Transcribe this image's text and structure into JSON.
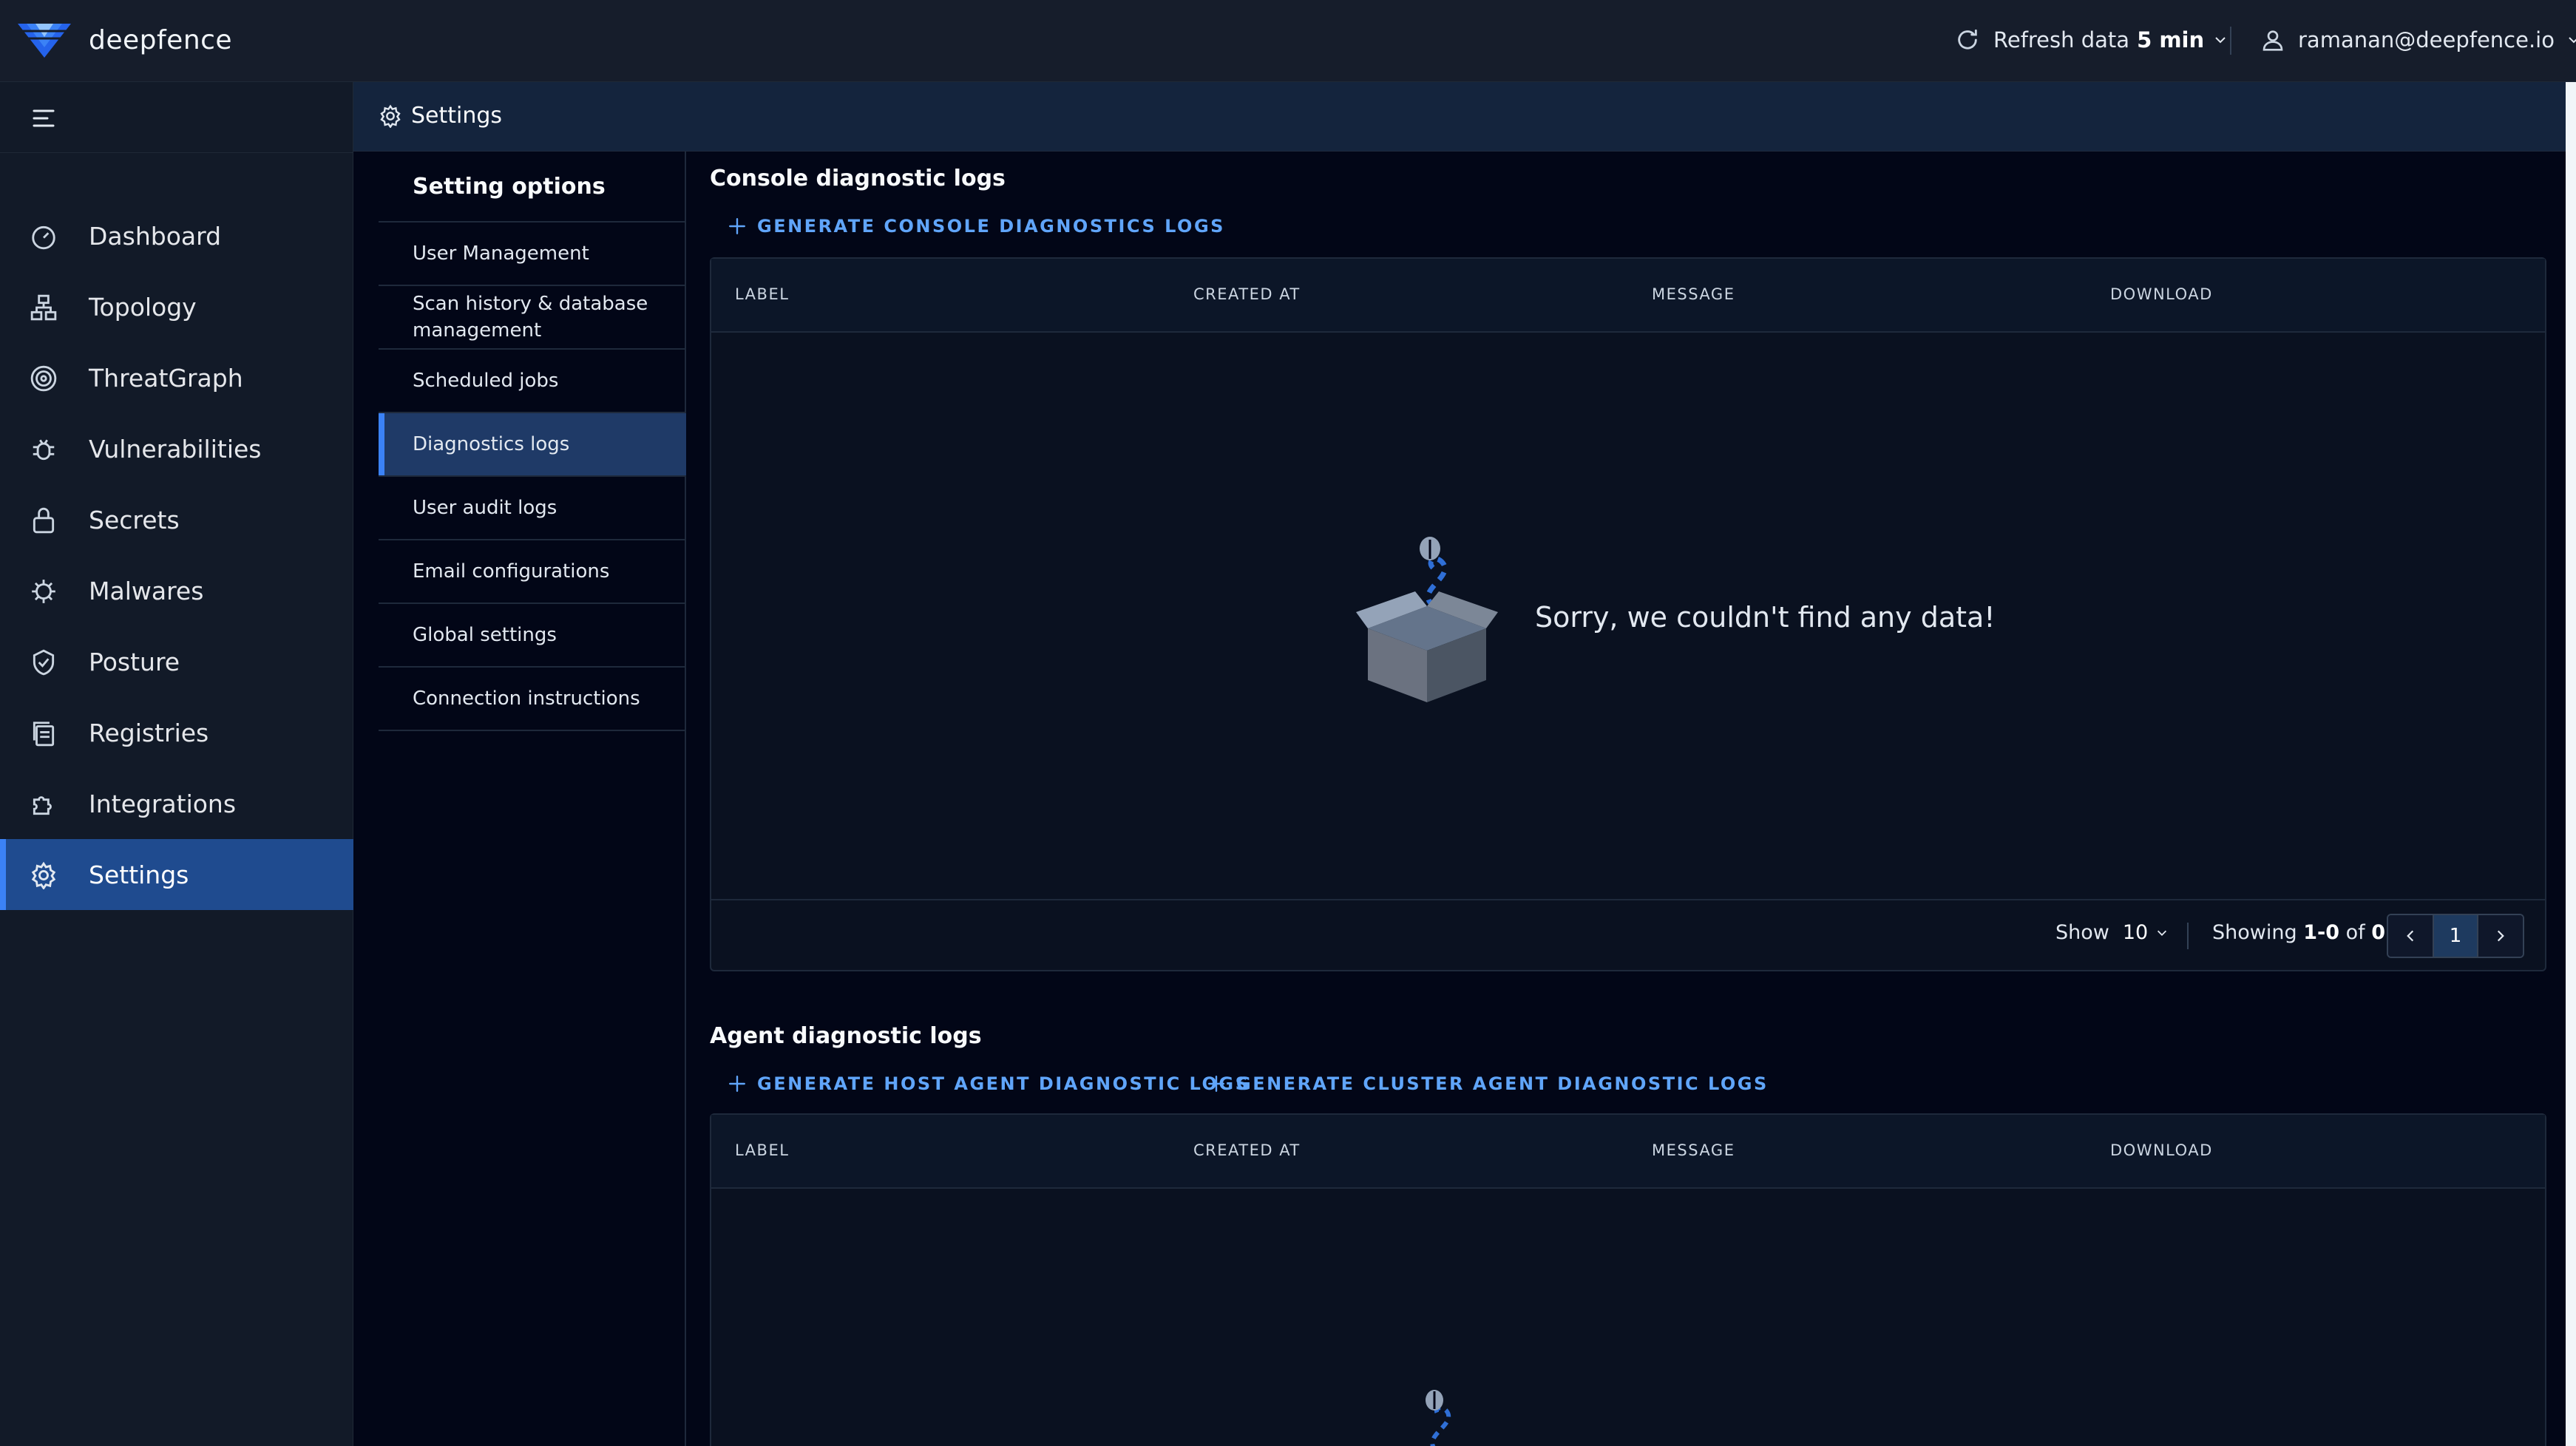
{
  "brand": {
    "name": "deepfence"
  },
  "topbar": {
    "refresh_label": "Refresh data",
    "refresh_value": "5 min",
    "user_email": "ramanan@deepfence.io"
  },
  "sidebar": {
    "items": [
      {
        "label": "Dashboard",
        "icon": "dashboard-icon"
      },
      {
        "label": "Topology",
        "icon": "topology-icon"
      },
      {
        "label": "ThreatGraph",
        "icon": "threatgraph-icon"
      },
      {
        "label": "Vulnerabilities",
        "icon": "bug-icon"
      },
      {
        "label": "Secrets",
        "icon": "lock-icon"
      },
      {
        "label": "Malwares",
        "icon": "malware-icon"
      },
      {
        "label": "Posture",
        "icon": "shield-icon"
      },
      {
        "label": "Registries",
        "icon": "registry-icon"
      },
      {
        "label": "Integrations",
        "icon": "puzzle-icon"
      },
      {
        "label": "Settings",
        "icon": "gear-icon",
        "active": true
      }
    ]
  },
  "page": {
    "title": "Settings"
  },
  "options": {
    "title": "Setting options",
    "items": [
      "User Management",
      "Scan history & database management",
      "Scheduled jobs",
      "Diagnostics logs",
      "User audit logs",
      "Email configurations",
      "Global settings",
      "Connection instructions"
    ],
    "active": "Diagnostics logs"
  },
  "console": {
    "title": "Console diagnostic logs",
    "action": "GENERATE CONSOLE DIAGNOSTICS LOGS",
    "columns": [
      "LABEL",
      "CREATED AT",
      "MESSAGE",
      "DOWNLOAD"
    ],
    "empty_message": "Sorry, we couldn't find any data!",
    "show_label": "Show",
    "page_size": "10",
    "showing_prefix": "Showing",
    "showing_range": "1-0",
    "showing_of": "of",
    "showing_total": "0",
    "current_page": "1"
  },
  "agent": {
    "title": "Agent diagnostic logs",
    "action_host": "GENERATE HOST AGENT DIAGNOSTIC LOGS",
    "action_cluster": "GENERATE CLUSTER AGENT DIAGNOSTIC LOGS",
    "columns": [
      "LABEL",
      "CREATED AT",
      "MESSAGE",
      "DOWNLOAD"
    ]
  },
  "colors": {
    "accent": "#3b82f6",
    "link": "#60a5fa",
    "background": "#020617",
    "sidebar": "#121a28",
    "active_nav": "#1f4b8f"
  }
}
